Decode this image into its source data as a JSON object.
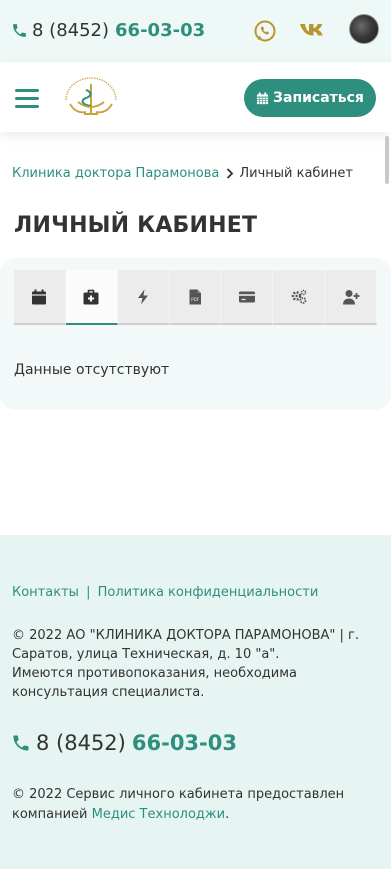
{
  "topbar": {
    "phone_prefix": "8 (8452)",
    "phone_number": "66-03-03"
  },
  "header": {
    "book_button_label": "Записаться"
  },
  "breadcrumb": {
    "home": "Клиника доктора Парамонова",
    "current": "Личный кабинет"
  },
  "page": {
    "title": "ЛИЧНЫЙ КАБИНЕТ",
    "empty_message": "Данные отсутствуют"
  },
  "tabs": [
    {
      "icon": "calendar-icon"
    },
    {
      "icon": "medical-kit-icon",
      "active": true
    },
    {
      "icon": "lightning-icon"
    },
    {
      "icon": "pdf-file-icon"
    },
    {
      "icon": "credit-card-icon"
    },
    {
      "icon": "gears-icon"
    },
    {
      "icon": "add-user-icon"
    }
  ],
  "footer": {
    "link_contacts": "Контакты",
    "link_divider": "|",
    "link_privacy": "Политика конфиденциальности",
    "copyright_line1": "© 2022 АО \"КЛИНИКА ДОКТОРА ПАРАМОНОВА\" | г. Саратов, улица Техническая, д. 10 \"а\".",
    "copyright_line2": "Имеются противопоказания, необходима консультация специалиста.",
    "phone_prefix": "8 (8452)",
    "phone_number": "66-03-03",
    "service_text": "© 2022 Сервис личного кабинета предоставлен компанией",
    "service_company": "Медис Технолоджи",
    "service_end": "."
  },
  "colors": {
    "accent": "#2f8f7f",
    "logo_gold": "#c9a23a",
    "footer_bg": "#e6f4f2"
  }
}
